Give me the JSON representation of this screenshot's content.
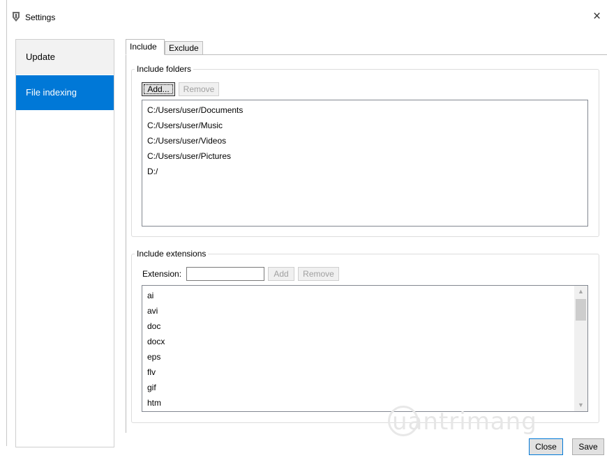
{
  "window": {
    "title": "Settings",
    "app_icon": "app-icon",
    "close_glyph": "×"
  },
  "sidebar": {
    "items": [
      {
        "label": "Update",
        "selected": false
      },
      {
        "label": "File indexing",
        "selected": true
      }
    ]
  },
  "tabs": [
    {
      "label": "Include",
      "active": true
    },
    {
      "label": "Exclude",
      "active": false
    }
  ],
  "include_folders": {
    "legend": "Include folders",
    "add_label": "Add...",
    "remove_label": "Remove",
    "folders": [
      "C:/Users/user/Documents",
      "C:/Users/user/Music",
      "C:/Users/user/Videos",
      "C:/Users/user/Pictures",
      "D:/"
    ]
  },
  "include_extensions": {
    "legend": "Include extensions",
    "extension_label": "Extension:",
    "extension_value": "",
    "add_label": "Add",
    "remove_label": "Remove",
    "extensions": [
      "ai",
      "avi",
      "doc",
      "docx",
      "eps",
      "flv",
      "gif",
      "htm"
    ]
  },
  "footer": {
    "close_label": "Close",
    "save_label": "Save"
  },
  "watermark": "uantrimang",
  "colors": {
    "accent": "#0078d7",
    "selected_text": "#ffffff",
    "border": "#bcbcbc"
  }
}
